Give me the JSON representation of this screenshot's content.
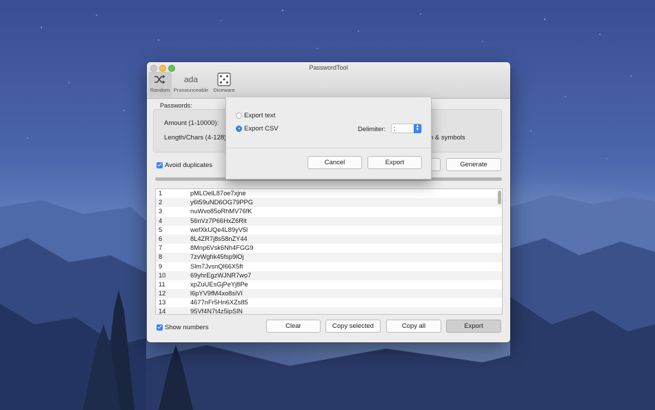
{
  "window": {
    "title": "PasswordTool"
  },
  "toolbar": {
    "random_label": "Random",
    "pronounceable_glyph": "ada",
    "pronounceable_label": "Pronounceable",
    "diceware_label": "Diceware"
  },
  "settings": {
    "passwords_label": "Passwords:",
    "amount_label": "Amount (1-10000):",
    "length_label": "Length/Chars (4-128)",
    "symbols_fragment": "n & symbols",
    "avoid_duplicates_label": "Avoid duplicates",
    "avoid_duplicates_checked": true,
    "generate_label": "Generate"
  },
  "passwords": [
    {
      "n": "1",
      "p": "pMLOelL87oe7xjne"
    },
    {
      "n": "2",
      "p": "y6t59uND6OG79PPG"
    },
    {
      "n": "3",
      "p": "nuWvo85oRhMV76fK"
    },
    {
      "n": "4",
      "p": "56nVz7P66HxZ6Rlt"
    },
    {
      "n": "5",
      "p": "wefXkUQe4L89yV5l"
    },
    {
      "n": "6",
      "p": "8L4ZR7j8s58nZY44"
    },
    {
      "n": "7",
      "p": "8Mnp6Vsk6Nh4FGG9"
    },
    {
      "n": "8",
      "p": "7zvWghk45fsp9lOj"
    },
    {
      "n": "9",
      "p": "Slm7JvsnQl66X5ft"
    },
    {
      "n": "10",
      "p": "69yhrEgzWJNR7wo7"
    },
    {
      "n": "11",
      "p": "xpZuUEsGjPeYj8Pe"
    },
    {
      "n": "12",
      "p": "l6pYV9fM4xo8siVI"
    },
    {
      "n": "13",
      "p": "4677nFr5Hn6XZs85"
    },
    {
      "n": "14",
      "p": "95Vf4N7t4z5ipSlN"
    }
  ],
  "bottom": {
    "show_numbers_label": "Show numbers",
    "clear_label": "Clear",
    "copy_selected_label": "Copy selected",
    "copy_all_label": "Copy all",
    "export_label": "Export"
  },
  "export_sheet": {
    "export_text_label": "Export text",
    "export_csv_label": "Export CSV",
    "selected_option": "csv",
    "delimiter_label": "Delimiter:",
    "delimiter_value": ";",
    "cancel_label": "Cancel",
    "export_label": "Export"
  },
  "colors": {
    "accent": "#3a84f6",
    "desktop": "#4b66ab"
  }
}
